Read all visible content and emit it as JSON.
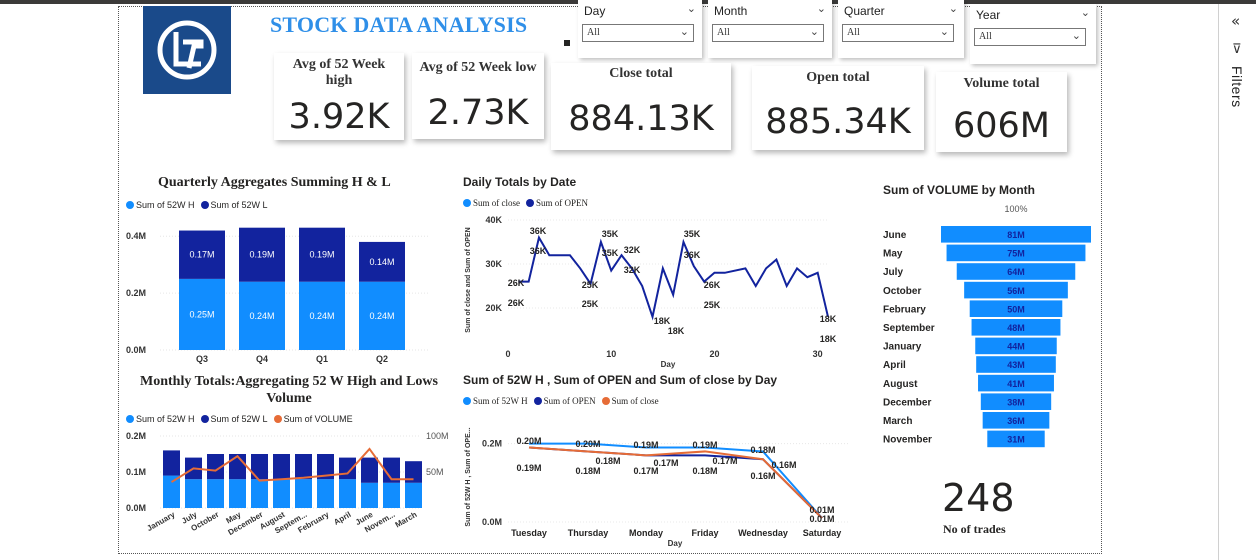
{
  "title": "STOCK DATA ANALYSIS",
  "filters_label": "Filters",
  "slicers": [
    {
      "label": "Day",
      "value": "All"
    },
    {
      "label": "Month",
      "value": "All"
    },
    {
      "label": "Quarter",
      "value": "All"
    },
    {
      "label": "Year",
      "value": "All"
    }
  ],
  "kpis": [
    {
      "title": "Avg of 52 Week high",
      "value": "3.92K"
    },
    {
      "title": "Avg of 52 Week low",
      "value": "2.73K"
    },
    {
      "title": "Close total",
      "value": "884.13K"
    },
    {
      "title": "Open total",
      "value": "885.34K"
    },
    {
      "title": "Volume total",
      "value": "606M"
    }
  ],
  "trades": {
    "value": "248",
    "label": "No of trades"
  },
  "colors": {
    "light_blue": "#118dff",
    "dark_blue": "#12239e",
    "orange": "#e66c37",
    "title_blue": "#2f8fe8",
    "logo_bg": "#1a4a8a"
  },
  "chart_data": [
    {
      "type": "bar",
      "title": "Quarterly Aggregates Summing H & L",
      "stacked": true,
      "categories": [
        "Q3",
        "Q4",
        "Q1",
        "Q2"
      ],
      "series": [
        {
          "name": "Sum of 52W H",
          "values": [
            0.25,
            0.24,
            0.24,
            0.24
          ],
          "labels": [
            "0.25M",
            "0.24M",
            "0.24M",
            "0.24M"
          ],
          "color": "#118dff"
        },
        {
          "name": "Sum of 52W L",
          "values": [
            0.17,
            0.19,
            0.19,
            0.14
          ],
          "labels": [
            "0.17M",
            "0.19M",
            "0.19M",
            "0.14M"
          ],
          "color": "#12239e"
        }
      ],
      "yticks": [
        "0.0M",
        "0.2M",
        "0.4M"
      ],
      "ylim": [
        0,
        0.45
      ]
    },
    {
      "type": "line",
      "title": "Daily Totals by Date",
      "xlabel": "Day",
      "ylabel": "Sum of close and Sum of OPEN",
      "xticks": [
        "0",
        "10",
        "20",
        "30"
      ],
      "yticks": [
        "20K",
        "30K",
        "40K"
      ],
      "ylim": [
        15000,
        40000
      ],
      "xlim": [
        0,
        31
      ],
      "series": [
        {
          "name": "Sum of close",
          "color": "#118dff"
        },
        {
          "name": "Sum of OPEN",
          "color": "#12239e",
          "x": [
            1,
            2,
            3,
            4,
            6,
            7,
            8,
            9,
            10,
            11,
            12,
            13,
            14,
            15,
            16,
            17,
            18,
            19,
            20,
            21,
            23,
            24,
            25,
            26,
            27,
            28,
            29,
            30,
            31
          ],
          "y": [
            26000,
            26000,
            36000,
            32000,
            32000,
            29000,
            25500,
            35000,
            28500,
            32000,
            29000,
            25000,
            18000,
            29000,
            23000,
            35000,
            29500,
            26000,
            28000,
            28000,
            29000,
            25000,
            29000,
            31000,
            25000,
            29000,
            27000,
            28000,
            18000
          ]
        }
      ],
      "point_labels": [
        "26K",
        "26K",
        "36K",
        "36K",
        "35K",
        "35K",
        "32K",
        "32K",
        "25K",
        "25K",
        "18K",
        "18K",
        "35K",
        "36K",
        "26K",
        "25K",
        "18K",
        "18K"
      ]
    },
    {
      "type": "bar",
      "title": "Sum of VOLUME by Month",
      "funnel": true,
      "top_label": "100%",
      "categories": [
        "June",
        "May",
        "July",
        "October",
        "February",
        "September",
        "January",
        "April",
        "August",
        "December",
        "March",
        "November"
      ],
      "values": [
        81,
        75,
        64,
        56,
        50,
        48,
        44,
        43,
        41,
        38,
        36,
        31
      ],
      "labels": [
        "81M",
        "75M",
        "64M",
        "56M",
        "50M",
        "48M",
        "44M",
        "43M",
        "41M",
        "38M",
        "36M",
        "31M"
      ],
      "color": "#118dff"
    },
    {
      "type": "bar",
      "title": "Monthly Totals:Aggregating 52 W High and Lows Volume",
      "stacked": true,
      "categories": [
        "January",
        "July",
        "October",
        "May",
        "December",
        "August",
        "Septem...",
        "February",
        "April",
        "June",
        "Novem...",
        "March"
      ],
      "series": [
        {
          "name": "Sum of 52W H",
          "values": [
            0.09,
            0.08,
            0.08,
            0.08,
            0.08,
            0.08,
            0.08,
            0.08,
            0.08,
            0.07,
            0.07,
            0.07
          ],
          "color": "#118dff"
        },
        {
          "name": "Sum of 52W L",
          "values": [
            0.07,
            0.06,
            0.07,
            0.07,
            0.07,
            0.07,
            0.07,
            0.07,
            0.06,
            0.07,
            0.07,
            0.06
          ],
          "color": "#12239e"
        },
        {
          "name": "Sum of VOLUME",
          "type": "line",
          "axis": "right",
          "values": [
            36,
            55,
            52,
            72,
            38,
            40,
            42,
            45,
            48,
            82,
            40,
            40
          ],
          "color": "#e66c37"
        }
      ],
      "yticks": [
        "0.0M",
        "0.1M",
        "0.2M"
      ],
      "ylim": [
        0,
        0.2
      ],
      "y2ticks": [
        "50M",
        "100M"
      ],
      "y2lim": [
        0,
        100
      ]
    },
    {
      "type": "line",
      "title": "Sum of 52W H , Sum of OPEN and Sum of close by Day",
      "xlabel": "Day",
      "ylabel": "Sum of 52W H , Sum of OPE...",
      "categories": [
        "Tuesday",
        "Thursday",
        "Monday",
        "Friday",
        "Wednesday",
        "Saturday"
      ],
      "yticks": [
        "0.0M",
        "0.2M"
      ],
      "ylim": [
        0,
        0.25
      ],
      "series": [
        {
          "name": "Sum of 52W H",
          "values": [
            0.2,
            0.2,
            0.19,
            0.19,
            0.18,
            0.01
          ],
          "labels": [
            "0.20M",
            "0.20M",
            "0.19M",
            "0.19M",
            "0.18M",
            "0.01M"
          ],
          "color": "#118dff"
        },
        {
          "name": "Sum of OPEN",
          "values": [
            0.19,
            0.18,
            0.17,
            0.17,
            0.16,
            0.01
          ],
          "color": "#12239e"
        },
        {
          "name": "Sum of close",
          "values": [
            0.19,
            0.18,
            0.17,
            0.18,
            0.16,
            0.01
          ],
          "labels": [
            "0.19M",
            "0.18M",
            "0.17M",
            "0.18M",
            "0.16M",
            "0.01M"
          ],
          "color": "#e66c37"
        }
      ],
      "mid_labels": [
        "0.18M",
        "0.17M",
        "0.17M",
        "0.16M"
      ]
    }
  ]
}
